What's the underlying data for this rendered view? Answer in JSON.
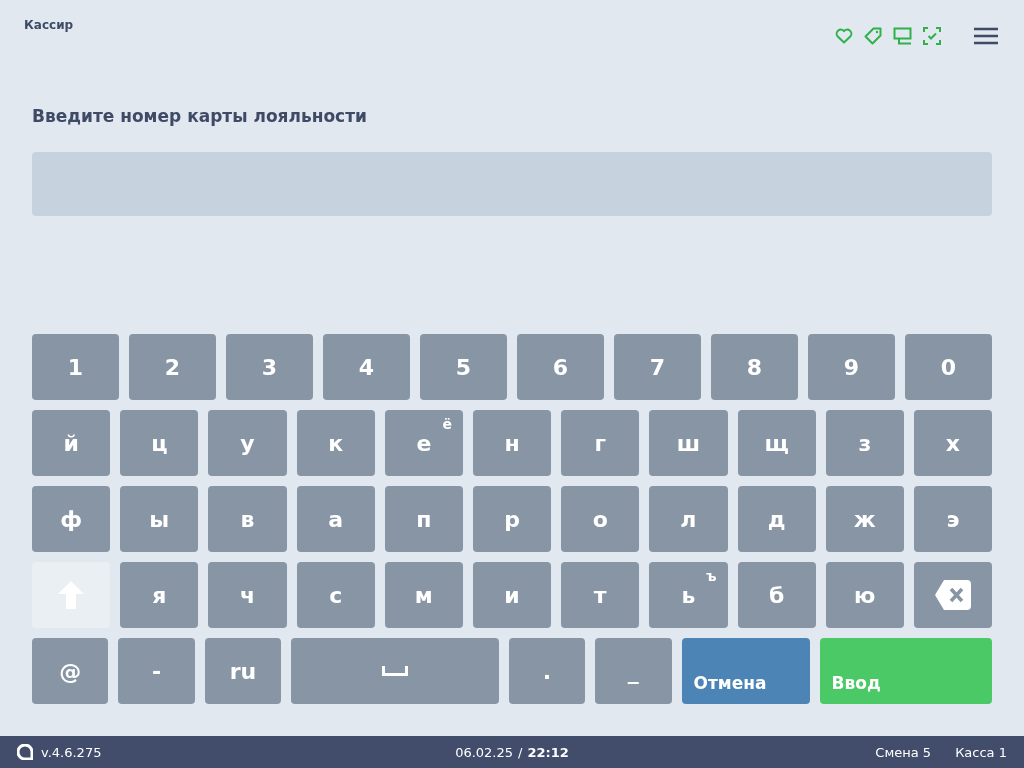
{
  "header": {
    "title": "Кассир"
  },
  "prompt": "Введите номер карты лояльности",
  "keyboard": {
    "digit_row": [
      {
        "kind": "char",
        "label": "1"
      },
      {
        "kind": "char",
        "label": "2"
      },
      {
        "kind": "char",
        "label": "3"
      },
      {
        "kind": "char",
        "label": "4"
      },
      {
        "kind": "char",
        "label": "5"
      },
      {
        "kind": "char",
        "label": "6"
      },
      {
        "kind": "char",
        "label": "7"
      },
      {
        "kind": "char",
        "label": "8"
      },
      {
        "kind": "char",
        "label": "9"
      },
      {
        "kind": "char",
        "label": "0"
      }
    ],
    "letter_rows": [
      [
        {
          "kind": "char",
          "label": "й"
        },
        {
          "kind": "char",
          "label": "ц"
        },
        {
          "kind": "char",
          "label": "у"
        },
        {
          "kind": "char",
          "label": "к"
        },
        {
          "kind": "char",
          "label": "е",
          "alt": "ё"
        },
        {
          "kind": "char",
          "label": "н"
        },
        {
          "kind": "char",
          "label": "г"
        },
        {
          "kind": "char",
          "label": "ш"
        },
        {
          "kind": "char",
          "label": "щ"
        },
        {
          "kind": "char",
          "label": "з"
        },
        {
          "kind": "char",
          "label": "х"
        }
      ],
      [
        {
          "kind": "char",
          "label": "ф"
        },
        {
          "kind": "char",
          "label": "ы"
        },
        {
          "kind": "char",
          "label": "в"
        },
        {
          "kind": "char",
          "label": "а"
        },
        {
          "kind": "char",
          "label": "п"
        },
        {
          "kind": "char",
          "label": "р"
        },
        {
          "kind": "char",
          "label": "о"
        },
        {
          "kind": "char",
          "label": "л"
        },
        {
          "kind": "char",
          "label": "д"
        },
        {
          "kind": "char",
          "label": "ж"
        },
        {
          "kind": "char",
          "label": "э"
        }
      ],
      [
        {
          "kind": "shift"
        },
        {
          "kind": "char",
          "label": "я"
        },
        {
          "kind": "char",
          "label": "ч"
        },
        {
          "kind": "char",
          "label": "с"
        },
        {
          "kind": "char",
          "label": "м"
        },
        {
          "kind": "char",
          "label": "и"
        },
        {
          "kind": "char",
          "label": "т"
        },
        {
          "kind": "char",
          "label": "ь",
          "alt": "ъ"
        },
        {
          "kind": "char",
          "label": "б"
        },
        {
          "kind": "char",
          "label": "ю"
        },
        {
          "kind": "backspace"
        }
      ]
    ],
    "bottom_row": [
      {
        "kind": "char",
        "label": "@"
      },
      {
        "kind": "char",
        "label": "-"
      },
      {
        "kind": "char",
        "label": "ru"
      },
      {
        "kind": "space"
      },
      {
        "kind": "char",
        "label": "."
      },
      {
        "kind": "char",
        "label": "_"
      },
      {
        "kind": "cancel",
        "label": "Отмена"
      },
      {
        "kind": "enter",
        "label": "Ввод"
      }
    ]
  },
  "status_bar": {
    "version": "v.4.6.275",
    "date": "06.02.25",
    "separator": "/",
    "time": "22:12",
    "shift": "Смена 5",
    "register": "Касса 1"
  }
}
